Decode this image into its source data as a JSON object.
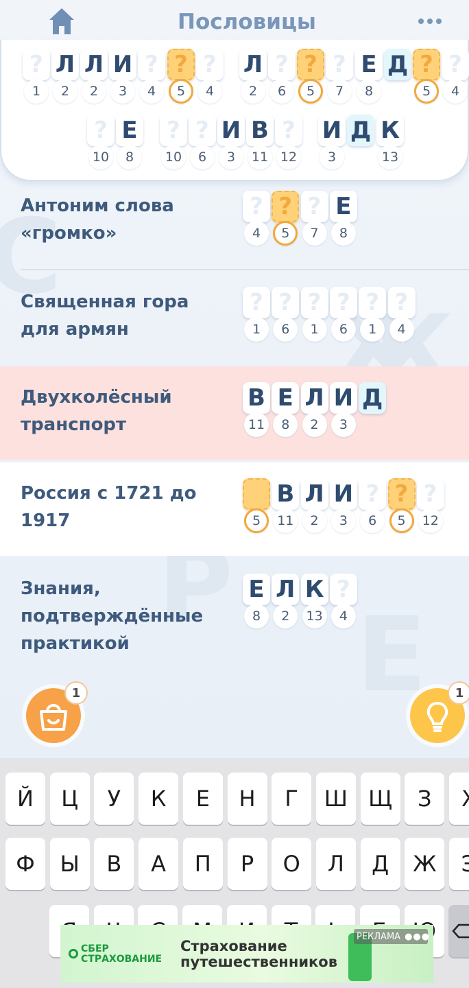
{
  "header": {
    "title": "Пословицы"
  },
  "phrase": {
    "line1": [
      {
        "letter": "?",
        "num": "1",
        "state": "empty"
      },
      {
        "letter": "Л",
        "num": "2",
        "state": "filled"
      },
      {
        "letter": "Л",
        "num": "2",
        "state": "filled"
      },
      {
        "letter": "И",
        "num": "3",
        "state": "filled"
      },
      {
        "letter": "?",
        "num": "4",
        "state": "empty"
      },
      {
        "letter": "?",
        "num": "5",
        "state": "gold"
      },
      {
        "letter": "?",
        "num": "4",
        "state": "empty"
      },
      {
        "letter": "Л",
        "num": "2",
        "state": "filled"
      },
      {
        "letter": "?",
        "num": "6",
        "state": "empty"
      },
      {
        "letter": "?",
        "num": "5",
        "state": "gold"
      },
      {
        "letter": "?",
        "num": "7",
        "state": "empty"
      },
      {
        "letter": "Е",
        "num": "8",
        "state": "filled"
      },
      {
        "letter": "Д",
        "num": "",
        "state": "hint"
      },
      {
        "letter": "?",
        "num": "5",
        "state": "gold"
      },
      {
        "letter": "?",
        "num": "4",
        "state": "empty"
      }
    ],
    "line2": [
      {
        "letter": "?",
        "num": "10",
        "state": "empty"
      },
      {
        "letter": "Е",
        "num": "8",
        "state": "filled"
      },
      {
        "letter": "?",
        "num": "10",
        "state": "empty"
      },
      {
        "letter": "?",
        "num": "6",
        "state": "empty"
      },
      {
        "letter": "И",
        "num": "3",
        "state": "filled"
      },
      {
        "letter": "В",
        "num": "11",
        "state": "filled"
      },
      {
        "letter": "?",
        "num": "12",
        "state": "empty"
      },
      {
        "letter": "И",
        "num": "3",
        "state": "filled"
      },
      {
        "letter": "Д",
        "num": "",
        "state": "hint"
      },
      {
        "letter": "К",
        "num": "13",
        "state": "filled"
      }
    ]
  },
  "clues": [
    {
      "text": "Антоним слова\n«громко»",
      "cells": [
        {
          "letter": "?",
          "num": "4",
          "state": "empty"
        },
        {
          "letter": "?",
          "num": "5",
          "state": "gold"
        },
        {
          "letter": "?",
          "num": "7",
          "state": "empty"
        },
        {
          "letter": "Е",
          "num": "8",
          "state": "filled"
        }
      ]
    },
    {
      "text": "Священная гора\nдля армян",
      "cells": [
        {
          "letter": "?",
          "num": "1",
          "state": "empty"
        },
        {
          "letter": "?",
          "num": "6",
          "state": "empty"
        },
        {
          "letter": "?",
          "num": "1",
          "state": "empty"
        },
        {
          "letter": "?",
          "num": "6",
          "state": "empty"
        },
        {
          "letter": "?",
          "num": "1",
          "state": "empty"
        },
        {
          "letter": "?",
          "num": "4",
          "state": "empty"
        }
      ]
    },
    {
      "text": "Двухколёсный\nтранспорт",
      "cells": [
        {
          "letter": "В",
          "num": "11",
          "state": "filled"
        },
        {
          "letter": "Е",
          "num": "8",
          "state": "filled"
        },
        {
          "letter": "Л",
          "num": "2",
          "state": "filled"
        },
        {
          "letter": "И",
          "num": "3",
          "state": "filled"
        },
        {
          "letter": "Д",
          "num": "",
          "state": "hint"
        }
      ]
    },
    {
      "text": "Россия с 1721 до\n1917",
      "cells": [
        {
          "letter": "",
          "num": "5",
          "state": "gold"
        },
        {
          "letter": "В",
          "num": "11",
          "state": "filled"
        },
        {
          "letter": "Л",
          "num": "2",
          "state": "filled"
        },
        {
          "letter": "И",
          "num": "3",
          "state": "filled"
        },
        {
          "letter": "?",
          "num": "6",
          "state": "empty"
        },
        {
          "letter": "?",
          "num": "5",
          "state": "gold"
        },
        {
          "letter": "?",
          "num": "12",
          "state": "empty"
        }
      ]
    },
    {
      "text": "Знания,\nподтверждённые\nпрактикой",
      "cells": [
        {
          "letter": "Е",
          "num": "8",
          "state": "filled"
        },
        {
          "letter": "Л",
          "num": "2",
          "state": "filled"
        },
        {
          "letter": "К",
          "num": "13",
          "state": "filled"
        },
        {
          "letter": "?",
          "num": "4",
          "state": "empty"
        }
      ]
    }
  ],
  "shop": {
    "badge": "1",
    "icon": "shopping-bag-icon"
  },
  "hint": {
    "badge": "1",
    "icon": "lightbulb-icon"
  },
  "keyboard": {
    "row1": [
      "Й",
      "Ц",
      "У",
      "К",
      "Е",
      "Н",
      "Г",
      "Ш",
      "Щ",
      "З",
      "Х"
    ],
    "row2": [
      "Ф",
      "Ы",
      "В",
      "А",
      "П",
      "Р",
      "О",
      "Л",
      "Д",
      "Ж",
      "Э"
    ],
    "row3": [
      "Я",
      "Ч",
      "С",
      "М",
      "И",
      "Т",
      "Ь",
      "Б",
      "Ю"
    ]
  },
  "ad": {
    "label": "РЕКЛАМА",
    "brand": "СБЕР\nСТРАХОВАНИЕ",
    "text": "Страхование\nпутешественников"
  },
  "colors": {
    "accent": "#f2a93b",
    "gold_tile": "#ffd27a",
    "highlight_row": "#fce1df",
    "title": "#7a96b9"
  }
}
